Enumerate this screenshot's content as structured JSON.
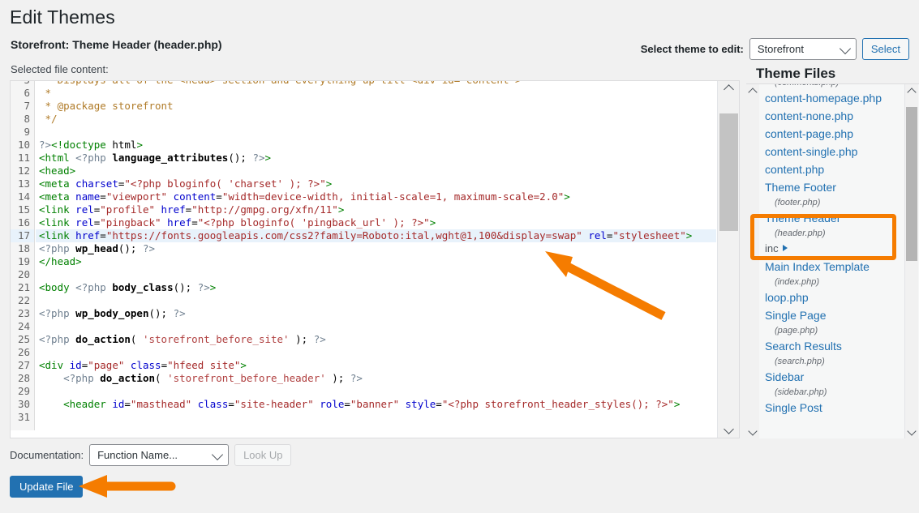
{
  "header": {
    "page_title": "Edit Themes",
    "file_subtitle": "Storefront: Theme Header (header.php)",
    "selected_file_label": "Selected file content:",
    "theme_select_label": "Select theme to edit:",
    "theme_selected": "Storefront",
    "select_button": "Select"
  },
  "theme_files": {
    "title": "Theme Files",
    "items": [
      {
        "label": "",
        "sub": "(comments.php)",
        "type": "file-partial"
      },
      {
        "label": "content-homepage.php",
        "sub": "",
        "type": "file"
      },
      {
        "label": "content-none.php",
        "sub": "",
        "type": "file"
      },
      {
        "label": "content-page.php",
        "sub": "",
        "type": "file"
      },
      {
        "label": "content-single.php",
        "sub": "",
        "type": "file"
      },
      {
        "label": "content.php",
        "sub": "",
        "type": "file"
      },
      {
        "label": "Theme Footer",
        "sub": "(footer.php)",
        "type": "file"
      },
      {
        "label": "Theme Header",
        "sub": "(header.php)",
        "type": "file-active"
      },
      {
        "label": "inc",
        "sub": "",
        "type": "folder"
      },
      {
        "label": "Main Index Template",
        "sub": "(index.php)",
        "type": "file"
      },
      {
        "label": "loop.php",
        "sub": "",
        "type": "file"
      },
      {
        "label": "Single Page",
        "sub": "(page.php)",
        "type": "file"
      },
      {
        "label": "Search Results",
        "sub": "(search.php)",
        "type": "file"
      },
      {
        "label": "Sidebar",
        "sub": "(sidebar.php)",
        "type": "file"
      },
      {
        "label": "Single Post",
        "sub": "",
        "type": "file"
      }
    ]
  },
  "editor": {
    "first_line_number": 5,
    "highlighted_line": 17,
    "lines": [
      {
        "n": 5,
        "text": " * Displays all of the <head> section and everything up till <div id=\"content\">"
      },
      {
        "n": 6,
        "text": " *"
      },
      {
        "n": 7,
        "text": " * @package storefront"
      },
      {
        "n": 8,
        "text": " */"
      },
      {
        "n": 9,
        "text": ""
      },
      {
        "n": 10,
        "text": "?><!doctype html>"
      },
      {
        "n": 11,
        "text": "<html <?php language_attributes(); ?>>"
      },
      {
        "n": 12,
        "text": "<head>"
      },
      {
        "n": 13,
        "text": "<meta charset=\"<?php bloginfo( 'charset' ); ?>\">"
      },
      {
        "n": 14,
        "text": "<meta name=\"viewport\" content=\"width=device-width, initial-scale=1, maximum-scale=2.0\">"
      },
      {
        "n": 15,
        "text": "<link rel=\"profile\" href=\"http://gmpg.org/xfn/11\">"
      },
      {
        "n": 16,
        "text": "<link rel=\"pingback\" href=\"<?php bloginfo( 'pingback_url' ); ?>\">"
      },
      {
        "n": 17,
        "text": "<link href=\"https://fonts.googleapis.com/css2?family=Roboto:ital,wght@1,100&display=swap\" rel=\"stylesheet\">"
      },
      {
        "n": 18,
        "text": "<?php wp_head(); ?>"
      },
      {
        "n": 19,
        "text": "</head>"
      },
      {
        "n": 20,
        "text": ""
      },
      {
        "n": 21,
        "text": "<body <?php body_class(); ?>>"
      },
      {
        "n": 22,
        "text": ""
      },
      {
        "n": 23,
        "text": "<?php wp_body_open(); ?>"
      },
      {
        "n": 24,
        "text": ""
      },
      {
        "n": 25,
        "text": "<?php do_action( 'storefront_before_site' ); ?>"
      },
      {
        "n": 26,
        "text": ""
      },
      {
        "n": 27,
        "text": "<div id=\"page\" class=\"hfeed site\">"
      },
      {
        "n": 28,
        "text": "    <?php do_action( 'storefront_before_header' ); ?>"
      },
      {
        "n": 29,
        "text": ""
      },
      {
        "n": 30,
        "text": "    <header id=\"masthead\" class=\"site-header\" role=\"banner\" style=\"<?php storefront_header_styles(); ?>\">"
      },
      {
        "n": 31,
        "text": ""
      }
    ]
  },
  "footer": {
    "documentation_label": "Documentation:",
    "documentation_selected": "Function Name...",
    "look_up_button": "Look Up",
    "update_file_button": "Update File"
  },
  "annotations": {
    "highlight_color": "#f57c00",
    "arrow_to_code_line": "points to line 17 stylesheet link",
    "arrow_to_update_button": "points to Update File button",
    "box_around": "Theme Header (header.php)"
  }
}
